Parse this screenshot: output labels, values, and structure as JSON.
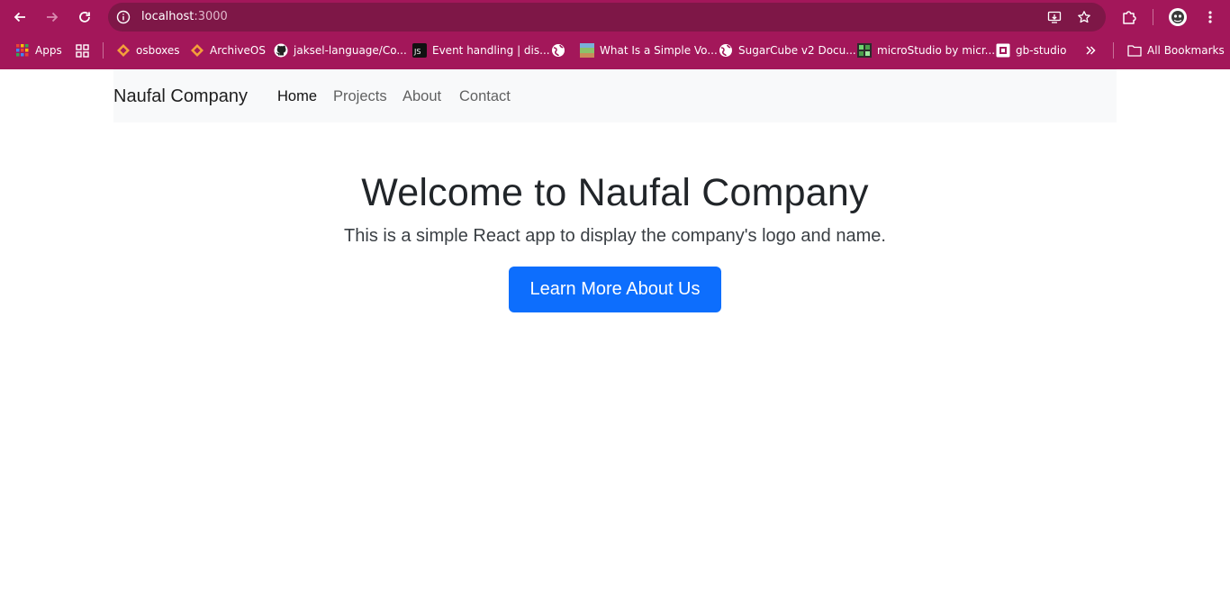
{
  "browser": {
    "url_host": "localhost",
    "url_port": ":3000",
    "bookmarks": [
      {
        "label": "Apps",
        "icon": "apps-grid-icon"
      },
      {
        "label": "",
        "icon": "tab-groups-icon"
      },
      {
        "label": "osboxes",
        "icon": "diamond-icon"
      },
      {
        "label": "ArchiveOS",
        "icon": "diamond-icon"
      },
      {
        "label": "jaksel-language/Co...",
        "icon": "github-icon"
      },
      {
        "label": "Event handling | dis...",
        "icon": "djs-icon"
      },
      {
        "label": "",
        "icon": "globe-icon"
      },
      {
        "label": "What Is a Simple Vo...",
        "icon": "site-icon"
      },
      {
        "label": "SugarCube v2 Docu...",
        "icon": "globe-icon"
      },
      {
        "label": "microStudio by micr...",
        "icon": "microstudio-icon"
      },
      {
        "label": "gb-studio",
        "icon": "gb-studio-icon"
      }
    ],
    "all_bookmarks": "All Bookmarks",
    "chrome_color": "#a3175a"
  },
  "navbar": {
    "brand": "Naufal Company",
    "links": [
      "Home",
      "Projects",
      "About",
      "Contact"
    ]
  },
  "hero": {
    "title": "Welcome to Naufal Company",
    "subtitle": "This is a simple React app to display the company's logo and name.",
    "button": "Learn More About Us",
    "button_color": "#0d6efd"
  }
}
